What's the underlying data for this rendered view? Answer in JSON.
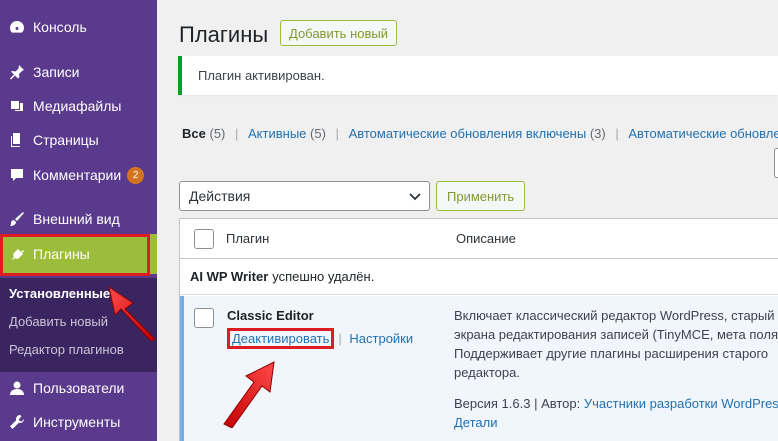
{
  "sidebar": {
    "items": [
      {
        "label": "Консоль",
        "icon": "dashboard-icon"
      },
      {
        "label": "Записи",
        "icon": "pin-icon"
      },
      {
        "label": "Медиафайлы",
        "icon": "media-icon"
      },
      {
        "label": "Страницы",
        "icon": "pages-icon"
      },
      {
        "label": "Комментарии",
        "icon": "comment-icon",
        "badge": "2"
      },
      {
        "label": "Внешний вид",
        "icon": "brush-icon"
      },
      {
        "label": "Плагины",
        "icon": "plugin-icon"
      },
      {
        "label": "Пользователи",
        "icon": "user-icon"
      },
      {
        "label": "Инструменты",
        "icon": "wrench-icon"
      }
    ],
    "submenu": [
      "Установленные",
      "Добавить новый",
      "Редактор плагинов"
    ],
    "active_color": "#9cbd3c",
    "background": "#5a3a8c"
  },
  "header": {
    "title": "Плагины",
    "add_new": "Добавить новый"
  },
  "notice": {
    "text": "Плагин активирован."
  },
  "filters": {
    "all": "Все",
    "all_count": "(5)",
    "active": "Активные",
    "active_count": "(5)",
    "auto_on": "Автоматические обновления включены",
    "auto_on_count": "(3)",
    "auto_off": "Автоматические обновления"
  },
  "bulk": {
    "select": "Действия",
    "apply": "Применить"
  },
  "table": {
    "col_plugin": "Плагин",
    "col_desc": "Описание",
    "deleted_name": "AI WP Writer",
    "deleted_text": "успешно удалён.",
    "plugin": {
      "name": "Classic Editor",
      "deactivate": "Деактивировать",
      "settings": "Настройки",
      "sep": "|",
      "desc_lines": [
        "Включает классический редактор WordPress, старый вид",
        "экрана редактирования записей (TinyMCE, мета поля",
        "Поддерживает другие плагины расширения старого",
        "редактора."
      ],
      "version": "Версия 1.6.3",
      "author_prefix": "| Автор:",
      "author": "Участники разработки WordPress",
      "details": "Детали"
    }
  },
  "colors": {
    "highlight": "#e11b22",
    "link": "#2271b1",
    "notice": "#00a32a"
  }
}
